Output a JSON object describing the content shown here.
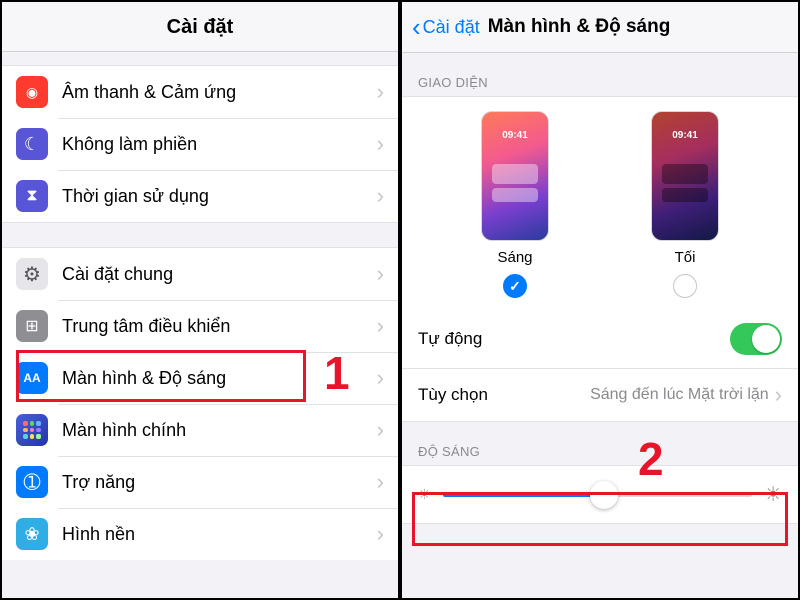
{
  "callouts": {
    "one": "1",
    "two": "2"
  },
  "left": {
    "title": "Cài đặt",
    "groups": [
      {
        "items": [
          {
            "icon": "speaker-icon",
            "bg": "bg-red",
            "label": "Âm thanh & Cảm ứng"
          },
          {
            "icon": "moon-icon",
            "bg": "bg-purple",
            "label": "Không làm phiền"
          },
          {
            "icon": "hourglass-icon",
            "bg": "bg-hourglass",
            "label": "Thời gian sử dụng"
          }
        ]
      },
      {
        "items": [
          {
            "icon": "gear-icon",
            "bg": "bg-gear",
            "label": "Cài đặt chung"
          },
          {
            "icon": "control-center-icon",
            "bg": "bg-gray",
            "label": "Trung tâm điều khiển"
          },
          {
            "icon": "display-icon",
            "bg": "bg-blue",
            "label": "Màn hình & Độ sáng",
            "highlighted": true
          },
          {
            "icon": "home-screen-icon",
            "bg": "icon-home",
            "label": "Màn hình chính"
          },
          {
            "icon": "accessibility-icon",
            "bg": "bg-teal",
            "label": "Trợ năng"
          },
          {
            "icon": "wallpaper-icon",
            "bg": "bg-cyan",
            "label": "Hình nền"
          }
        ]
      }
    ]
  },
  "right": {
    "back_label": "Cài đặt",
    "title": "Màn hình & Độ sáng",
    "appearance_header": "GIAO DIỆN",
    "phone_time": "09:41",
    "light_label": "Sáng",
    "dark_label": "Tối",
    "light_selected": true,
    "auto_label": "Tự động",
    "auto_on": true,
    "options_label": "Tùy chọn",
    "options_value": "Sáng đến lúc Mặt trời lặn",
    "brightness_header": "ĐỘ SÁNG",
    "brightness_percent": 52
  }
}
